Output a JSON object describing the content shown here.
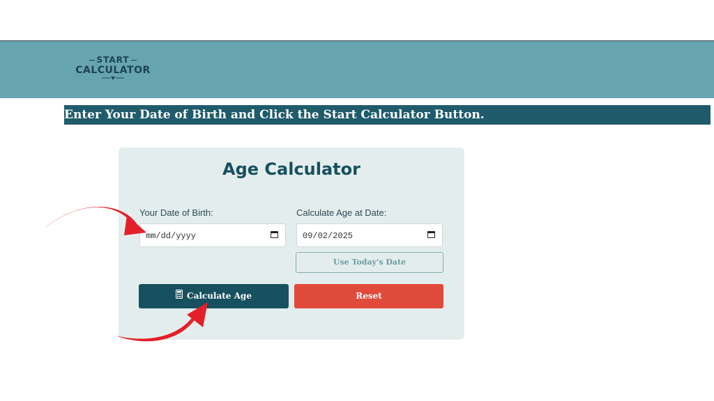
{
  "logo": {
    "line1": "START",
    "line2": "CALCULATOR"
  },
  "banner": {
    "text": "Enter Your Date of Birth and Click the Start Calculator Button."
  },
  "form": {
    "title": "Age Calculator",
    "dob_label": "Your Date of Birth:",
    "dob_value": "mm/dd/yyyy",
    "calc_date_label": "Calculate Age at Date:",
    "calc_date_value": "09/02/2025",
    "today_button": "Use Today's Date",
    "calculate_button": "Calculate Age",
    "reset_button": "Reset"
  },
  "icons": {
    "calendar": "calendar-icon",
    "calculator": "calculator-icon",
    "arrow": "red-arrow-icon"
  },
  "colors": {
    "header": "#66a4b0",
    "banner": "#1f5b6b",
    "primary": "#17505e",
    "reset": "#e04a3a",
    "arrow": "#e3202a"
  }
}
